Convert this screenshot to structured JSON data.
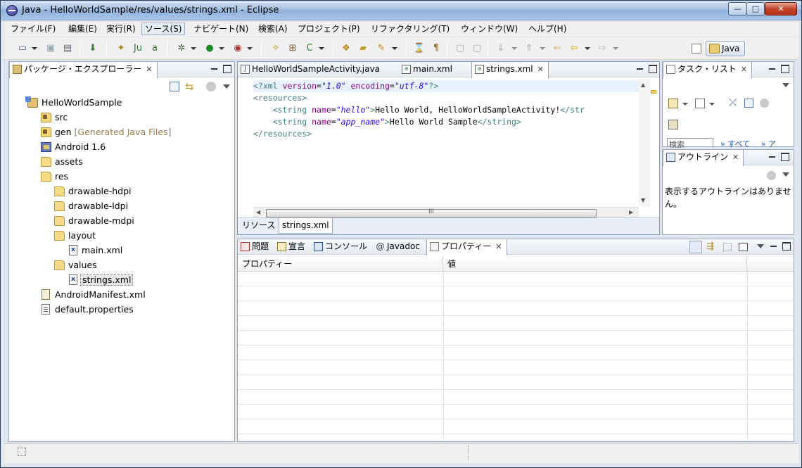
{
  "window": {
    "title": "Java - HelloWorldSample/res/values/strings.xml - Eclipse",
    "min": "—",
    "max": "□",
    "close": "✕"
  },
  "menu": [
    "ファイル(F)",
    "編集(E)",
    "実行(R)",
    "ソース(S)",
    "ナビゲート(N)",
    "検索(A)",
    "プロジェクト(P)",
    "リファクタリング(T)",
    "ウィンドウ(W)",
    "ヘルプ(H)"
  ],
  "perspective": {
    "label": "Java"
  },
  "package_explorer": {
    "title": "パッケージ・エクスプローラー",
    "tree": [
      {
        "label": "HelloWorldSample",
        "icon": "project-icon"
      },
      {
        "label": "src",
        "icon": "source-folder-icon"
      },
      {
        "label": "gen",
        "decoration": "[Generated Java Files]",
        "icon": "source-folder-icon"
      },
      {
        "label": "Android 1.6",
        "icon": "library-icon"
      },
      {
        "label": "assets",
        "icon": "folder-icon"
      },
      {
        "label": "res",
        "icon": "folder-icon"
      },
      {
        "label": "drawable-hdpi",
        "icon": "folder-icon"
      },
      {
        "label": "drawable-ldpi",
        "icon": "folder-icon"
      },
      {
        "label": "drawable-mdpi",
        "icon": "folder-icon"
      },
      {
        "label": "layout",
        "icon": "folder-icon"
      },
      {
        "label": "main.xml",
        "icon": "xml-file-icon"
      },
      {
        "label": "values",
        "icon": "folder-icon"
      },
      {
        "label": "strings.xml",
        "icon": "xml-file-icon"
      },
      {
        "label": "AndroidManifest.xml",
        "icon": "manifest-file-icon"
      },
      {
        "label": "default.properties",
        "icon": "properties-file-icon"
      }
    ]
  },
  "editor": {
    "tabs": [
      "HelloWorldSampleActivity.java",
      "main.xml",
      "strings.xml"
    ],
    "selected_tab": "strings.xml",
    "bottom_tabs": [
      "リソース",
      "strings.xml"
    ],
    "code": {
      "line1": {
        "open": "<?xml ",
        "attr1": "version",
        "eq1": "=",
        "val1": "\"1.0\"",
        "attr2": " encoding",
        "eq2": "=",
        "val2": "\"utf-8\"",
        "close": "?>"
      },
      "line2": {
        "tag": "<resources>"
      },
      "line3": {
        "open": "    <string ",
        "attr": "name",
        "eq": "=",
        "val": "\"hello\"",
        "gt": ">",
        "text": "Hello World, HelloWorldSampleActivity!",
        "end": "</str"
      },
      "line4": {
        "open": "    <string ",
        "attr": "name",
        "eq": "=",
        "val": "\"app_name\"",
        "gt": ">",
        "text": "Hello World Sample",
        "end": "</string>"
      },
      "line5": {
        "tag": "</resources>"
      }
    },
    "scroll_thumb_grip": "III"
  },
  "task_list": {
    "title": "タスク・リスト",
    "search_placeholder": "検索",
    "all_link": "» すべて",
    "more_link": "» ア"
  },
  "outline": {
    "title": "アウトライン",
    "empty_message": "表示するアウトラインはありません。"
  },
  "bottom_panel": {
    "tabs": [
      "問題",
      "宣言",
      "コンソール",
      "Javadoc",
      "プロパティー"
    ],
    "selected_tab": "プロパティー",
    "columns": [
      "プロパティー",
      "値"
    ]
  }
}
